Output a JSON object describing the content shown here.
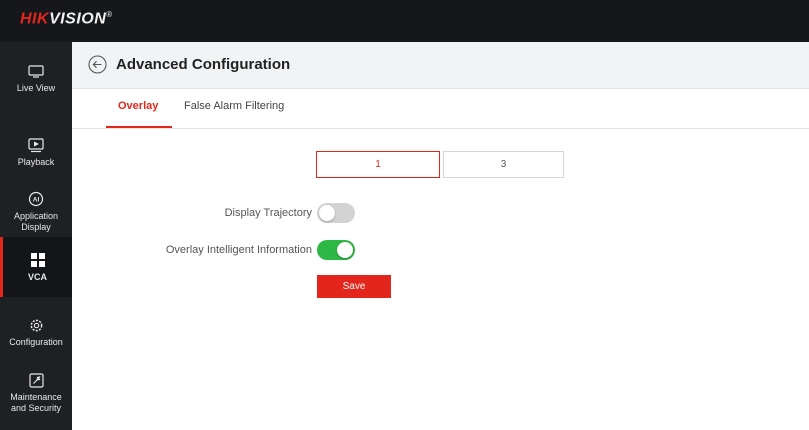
{
  "brand": {
    "logo_red": "HIK",
    "logo_white": "VISION",
    "logo_mark": "®"
  },
  "sidebar": {
    "items": [
      {
        "label": "Live View",
        "icon": "monitor-icon",
        "active": false
      },
      {
        "label": "Playback",
        "icon": "playback-icon",
        "active": false
      },
      {
        "label": "Application Display",
        "icon": "ai-icon",
        "active": false
      },
      {
        "label": "VCA",
        "icon": "grid-icon",
        "active": true
      },
      {
        "label": "Configuration",
        "icon": "gear-icon",
        "active": false
      },
      {
        "label": "Maintenance and Security",
        "icon": "maintenance-icon",
        "active": false
      }
    ]
  },
  "header": {
    "title": "Advanced Configuration",
    "back_icon": "back-arrow-icon"
  },
  "tabs": [
    {
      "label": "Overlay",
      "active": true
    },
    {
      "label": "False Alarm Filtering",
      "active": false
    }
  ],
  "channels": [
    {
      "label": "1",
      "selected": true
    },
    {
      "label": "3",
      "selected": false
    }
  ],
  "settings": {
    "display_trajectory": {
      "label": "Display Trajectory",
      "enabled": false
    },
    "overlay_intelligent_info": {
      "label": "Overlay Intelligent Information",
      "enabled": true
    }
  },
  "actions": {
    "save_label": "Save"
  },
  "colors": {
    "accent": "#e3261c",
    "toggle_on": "#2db744",
    "toggle_off": "#d3d3d3",
    "sidebar_bg": "#1f2024",
    "topbar_bg": "#16171b"
  }
}
